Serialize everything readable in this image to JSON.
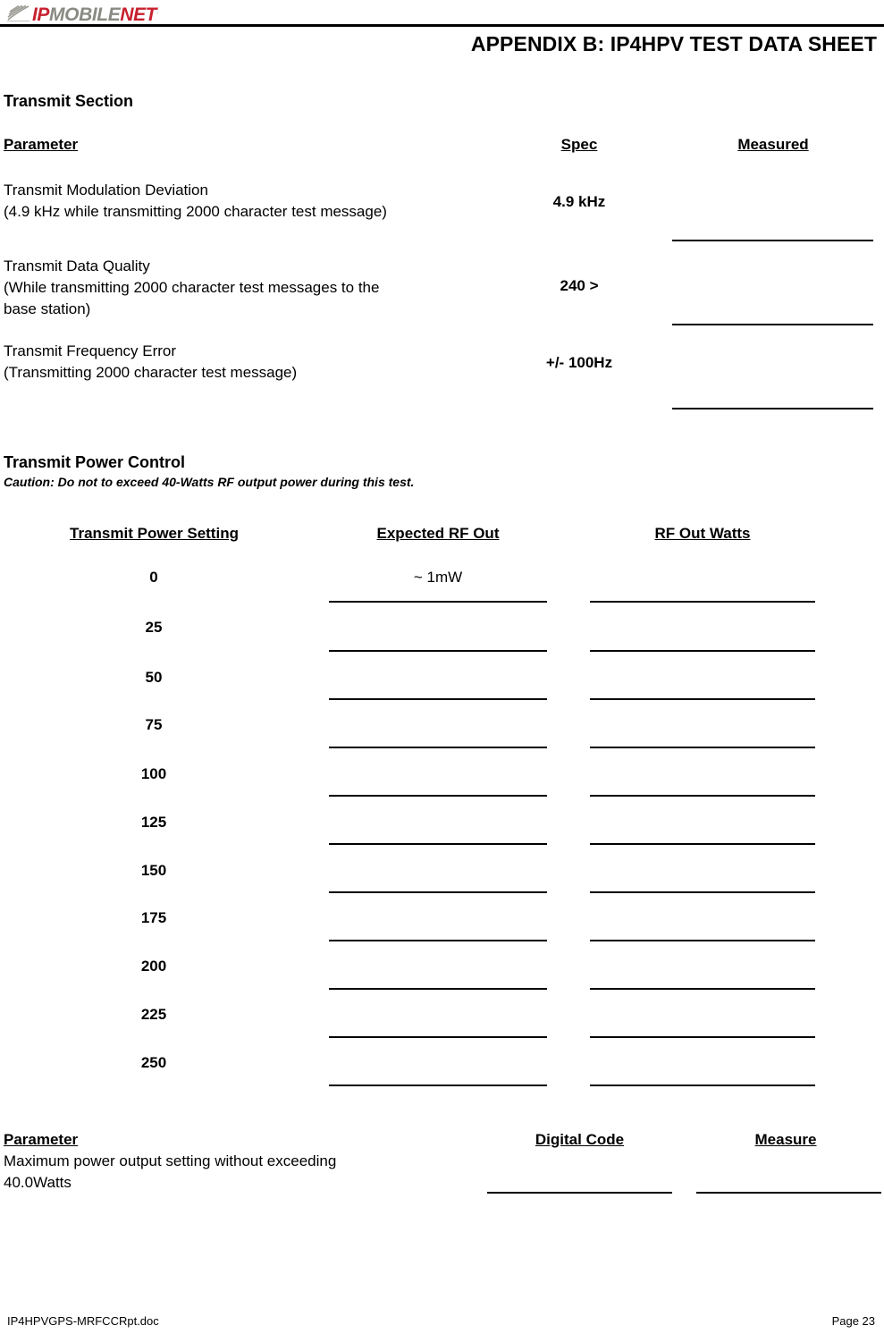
{
  "logo": {
    "part1": "IP",
    "part2": "MOBILE",
    "part3": "NET",
    "tm": ".",
    "red": "#c8202e",
    "gray": "#8a8a82"
  },
  "header": {
    "title": "APPENDIX B:  IP4HPV TEST DATA SHEET"
  },
  "transmit_section": {
    "heading": "Transmit Section",
    "columns": {
      "parameter": "Parameter",
      "spec": "Spec",
      "measured": "Measured"
    },
    "rows": [
      {
        "parameter": "Transmit Modulation Deviation\n(4.9 kHz while transmitting 2000 character test message)",
        "spec": "4.9 kHz",
        "measured": ""
      },
      {
        "parameter": "Transmit Data Quality\n(While transmitting 2000 character test messages to the\nbase station)",
        "spec": "240 >",
        "measured": ""
      },
      {
        "parameter": "Transmit Frequency Error\n(Transmitting 2000 character test message)",
        "spec": "+/- 100Hz",
        "measured": ""
      }
    ]
  },
  "power_control": {
    "heading": "Transmit Power Control",
    "caution": "Caution: Do not to exceed 40-Watts RF output power during this test.",
    "columns": {
      "setting": "Transmit Power Setting",
      "expected": "Expected RF Out",
      "watts": "RF Out Watts"
    },
    "rows": [
      {
        "setting": "0",
        "expected": "~ 1mW",
        "watts": ""
      },
      {
        "setting": "25",
        "expected": "",
        "watts": ""
      },
      {
        "setting": "50",
        "expected": "",
        "watts": ""
      },
      {
        "setting": "75",
        "expected": "",
        "watts": ""
      },
      {
        "setting": "100",
        "expected": "",
        "watts": ""
      },
      {
        "setting": "125",
        "expected": "",
        "watts": ""
      },
      {
        "setting": "150",
        "expected": "",
        "watts": ""
      },
      {
        "setting": "175",
        "expected": "",
        "watts": ""
      },
      {
        "setting": "200",
        "expected": "",
        "watts": ""
      },
      {
        "setting": "225",
        "expected": "",
        "watts": ""
      },
      {
        "setting": "250",
        "expected": "",
        "watts": ""
      }
    ]
  },
  "max_power": {
    "columns": {
      "parameter": "Parameter",
      "digital_code": "Digital Code",
      "measure": "Measure"
    },
    "description": "Maximum power output setting without exceeding\n40.0Watts",
    "digital_code": "",
    "measure": ""
  },
  "footer": {
    "document": "IP4HPVGPS-MRFCCRpt.doc",
    "page": "Page 23"
  }
}
